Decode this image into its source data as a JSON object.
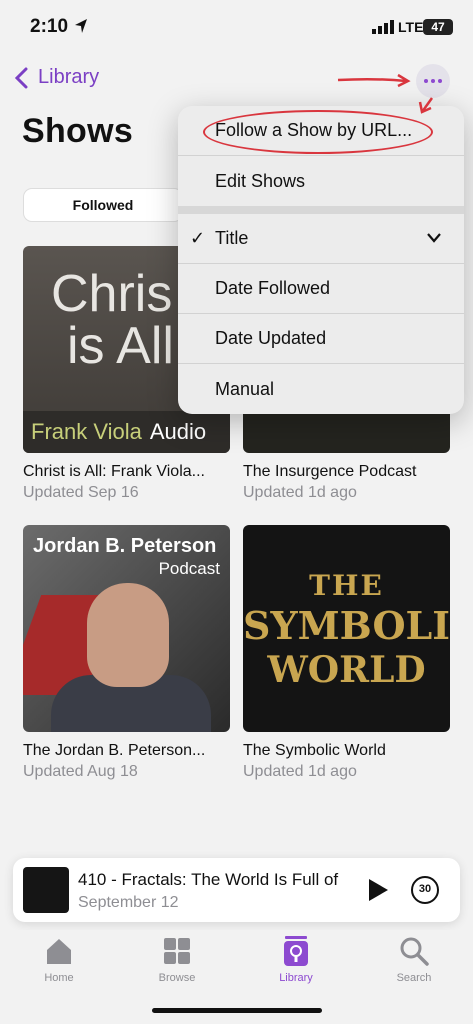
{
  "status": {
    "time": "2:10",
    "network": "LTE",
    "battery": "47"
  },
  "nav": {
    "back_label": "Library"
  },
  "page": {
    "title": "Shows"
  },
  "segment": {
    "selected": "Followed"
  },
  "shows": [
    {
      "name": "Christ is All: Frank Viola...",
      "updated": "Updated Sep 16",
      "art_lines": [
        "Chris",
        "is All",
        "Frank Viola",
        "Audio"
      ]
    },
    {
      "name": "The Insurgence Podcast",
      "updated": "Updated 1d ago"
    },
    {
      "name": "The Jordan B. Peterson...",
      "updated": "Updated Aug 18",
      "art_lines": [
        "Jordan B. Peterson",
        "Podcast"
      ]
    },
    {
      "name": "The Symbolic World",
      "updated": "Updated 1d ago",
      "art_lines": [
        "THE",
        "SYMBOLIC",
        "WORLD"
      ]
    }
  ],
  "menu": {
    "items": [
      "Follow a Show by URL...",
      "Edit Shows"
    ],
    "sort_items": [
      "Title",
      "Date Followed",
      "Date Updated",
      "Manual"
    ],
    "selected_sort": "Title"
  },
  "player": {
    "title": "410 - Fractals: The World Is Full of",
    "date": "September 12",
    "skip_seconds": "30"
  },
  "tabs": [
    {
      "label": "Home"
    },
    {
      "label": "Browse"
    },
    {
      "label": "Library"
    },
    {
      "label": "Search"
    }
  ],
  "colors": {
    "accent": "#8d4ad0",
    "annotation": "#d9363e"
  }
}
